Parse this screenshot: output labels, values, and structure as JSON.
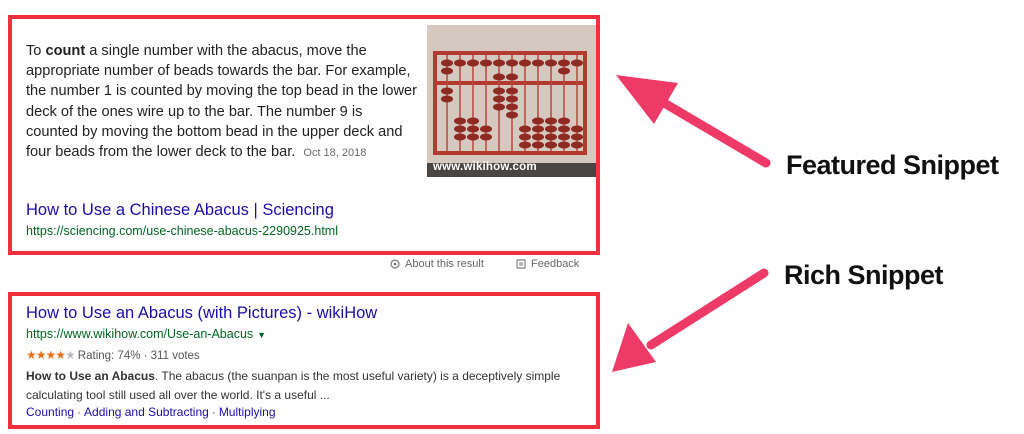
{
  "featured": {
    "text_prefix": "To ",
    "text_bold": "count",
    "text_body": " a single number with the abacus, move the appropriate number of beads towards the bar. For example, the number 1 is counted by moving the top bead in the lower deck of the ones wire up to the bar. The number 9 is counted by moving the bottom bead in the upper deck and four beads from the lower deck to the bar.",
    "date": "Oct 18, 2018",
    "image_caption": "www.wikihow.com",
    "link_title": "How to Use a Chinese Abacus | Sciencing",
    "url": "https://sciencing.com/use-chinese-abacus-2290925.html",
    "about_label": "About this result",
    "feedback_label": "Feedback"
  },
  "rich": {
    "title": "How to Use an Abacus (with Pictures) - wikiHow",
    "url": "https://www.wikihow.com/Use-an-Abacus",
    "stars_filled": "★★★★",
    "stars_empty": "★",
    "rating_text": "Rating: 74% · 311 votes",
    "desc_bold": "How to Use an Abacus",
    "desc_body": ". The abacus (the suanpan is the most useful variety) is a deceptively simple calculating tool still used all over the world. It's a useful ...",
    "sitelinks": [
      "Counting",
      "Adding and Subtracting",
      "Multiplying"
    ],
    "sitelink_sep": "·"
  },
  "labels": {
    "featured": "Featured Snippet",
    "rich": "Rich Snippet"
  },
  "colors": {
    "highlight_red": "#f0313d",
    "arrow_pink": "#ee3a66",
    "link_blue": "#1a0dab",
    "url_green": "#006621",
    "star_orange": "#e7711b"
  },
  "icons": {
    "about": "info-circle-icon",
    "feedback": "feedback-icon",
    "caret": "caret-down-icon"
  }
}
